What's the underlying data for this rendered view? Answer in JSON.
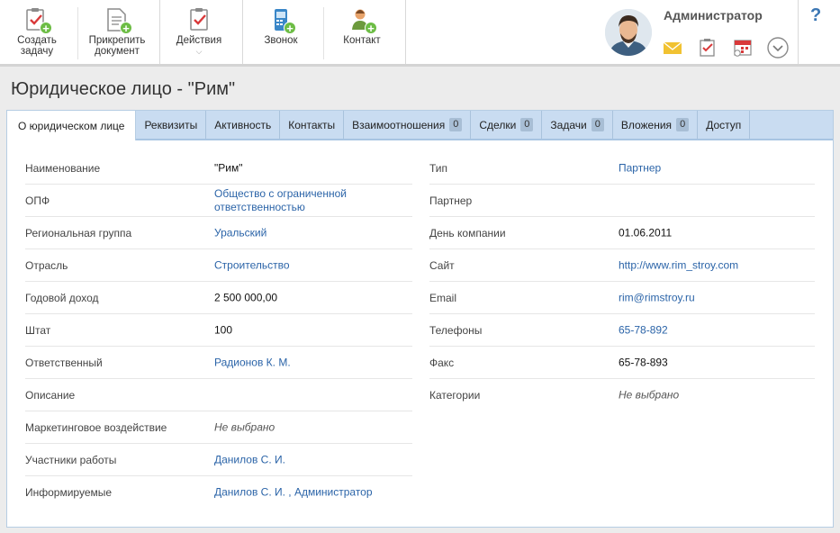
{
  "toolbar": {
    "create_task": "Создать\nзадачу",
    "attach_doc": "Прикрепить\nдокумент",
    "actions": "Действия",
    "call": "Звонок",
    "contact": "Контакт"
  },
  "user": {
    "name": "Администратор"
  },
  "help": "?",
  "page": {
    "title": "Юридическое лицо - \"Рим\""
  },
  "tabs": [
    {
      "label": "О юридическом лице",
      "count": null
    },
    {
      "label": "Реквизиты",
      "count": null
    },
    {
      "label": "Активность",
      "count": null
    },
    {
      "label": "Контакты",
      "count": null
    },
    {
      "label": "Взаимоотношения",
      "count": "0"
    },
    {
      "label": "Сделки",
      "count": "0"
    },
    {
      "label": "Задачи",
      "count": "0"
    },
    {
      "label": "Вложения",
      "count": "0"
    },
    {
      "label": "Доступ",
      "count": null
    }
  ],
  "left_fields": [
    {
      "label": "Наименование",
      "value": "\"Рим\""
    },
    {
      "label": "ОПФ",
      "value": "Общество с ограниченной\nответственностью"
    },
    {
      "label": "Региональная группа",
      "value": "Уральский"
    },
    {
      "label": "Отрасль",
      "value": "Строительство"
    },
    {
      "label": "Годовой доход",
      "value": "2 500 000,00"
    },
    {
      "label": "Штат",
      "value": "100"
    },
    {
      "label": "Ответственный",
      "value": "Радионов К. М."
    },
    {
      "label": "Описание",
      "value": ""
    },
    {
      "label": "Маркетинговое воздействие",
      "value": "Не выбрано"
    },
    {
      "label": "Участники работы",
      "value": "Данилов С. И."
    },
    {
      "label": "Информируемые",
      "value": "Данилов С. И. , Администратор"
    }
  ],
  "right_fields": [
    {
      "label": "Тип",
      "value": "Партнер"
    },
    {
      "label": "Партнер",
      "value": ""
    },
    {
      "label": "День компании",
      "value": "01.06.2011"
    },
    {
      "label": "Сайт",
      "value": "http://www.rim_stroy.com"
    },
    {
      "label": "Email",
      "value": "rim@rimstroy.ru"
    },
    {
      "label": "Телефоны",
      "value": "65-78-892"
    },
    {
      "label": "Факс",
      "value": "65-78-893"
    },
    {
      "label": "Категории",
      "value": "Не выбрано"
    }
  ],
  "colors": {
    "link": "#2b64a8",
    "tab_bar": "#c9dcf1",
    "accent_red": "#d9393a",
    "accent_green": "#6dbd45",
    "mail_yellow": "#f1c232"
  },
  "icons": [
    "task-add-icon",
    "document-attach-icon",
    "actions-icon",
    "phone-icon",
    "contact-add-icon",
    "mail-icon",
    "tasks-icon",
    "calendar-icon",
    "chevron-down-icon",
    "help-icon"
  ]
}
